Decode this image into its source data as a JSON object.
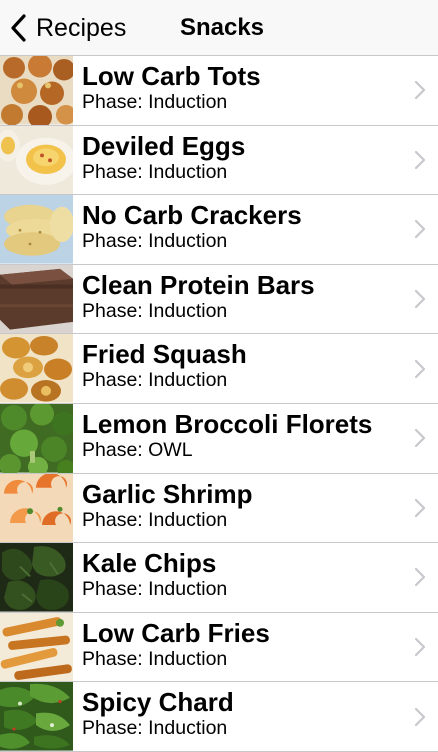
{
  "nav": {
    "back_label": "Recipes",
    "title": "Snacks"
  },
  "items": [
    {
      "title": "Low Carb Tots",
      "subtitle": "Phase: Induction",
      "image": "tots-photo"
    },
    {
      "title": "Deviled Eggs",
      "subtitle": "Phase: Induction",
      "image": "eggs-photo"
    },
    {
      "title": "No Carb Crackers",
      "subtitle": "Phase: Induction",
      "image": "crackers-photo"
    },
    {
      "title": "Clean Protein Bars",
      "subtitle": "Phase: Induction",
      "image": "protein-bars-photo"
    },
    {
      "title": "Fried Squash",
      "subtitle": "Phase: Induction",
      "image": "squash-photo"
    },
    {
      "title": "Lemon Broccoli Florets",
      "subtitle": "Phase: OWL",
      "image": "broccoli-photo"
    },
    {
      "title": "Garlic Shrimp",
      "subtitle": "Phase: Induction",
      "image": "shrimp-photo"
    },
    {
      "title": "Kale Chips",
      "subtitle": "Phase: Induction",
      "image": "kale-photo"
    },
    {
      "title": "Low Carb Fries",
      "subtitle": "Phase: Induction",
      "image": "fries-photo"
    },
    {
      "title": "Spicy Chard",
      "subtitle": "Phase: Induction",
      "image": "chard-photo"
    }
  ],
  "colors": {
    "navbar_bg": "#f8f8f8",
    "separator": "#c8c7cc",
    "chevron": "#c7c7cc"
  }
}
